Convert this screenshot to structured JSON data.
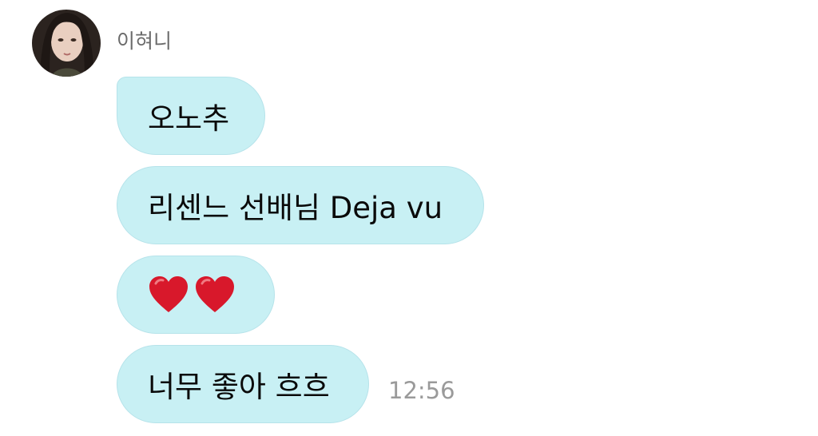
{
  "sender": {
    "name": "이혀니"
  },
  "messages": [
    {
      "text": "오노추"
    },
    {
      "text": "리센느 선배님 Deja vu"
    },
    {
      "emoji": "heart-icon heart-icon"
    },
    {
      "text": "너무 좋아 흐흐"
    }
  ],
  "timestamp": "12:56",
  "colors": {
    "bubble": "#c8f0f4",
    "bubble_border": "#b6e3ea",
    "sender_text": "#6b6b6b",
    "timestamp": "#9a9a9a",
    "heart": "#d8182b"
  }
}
